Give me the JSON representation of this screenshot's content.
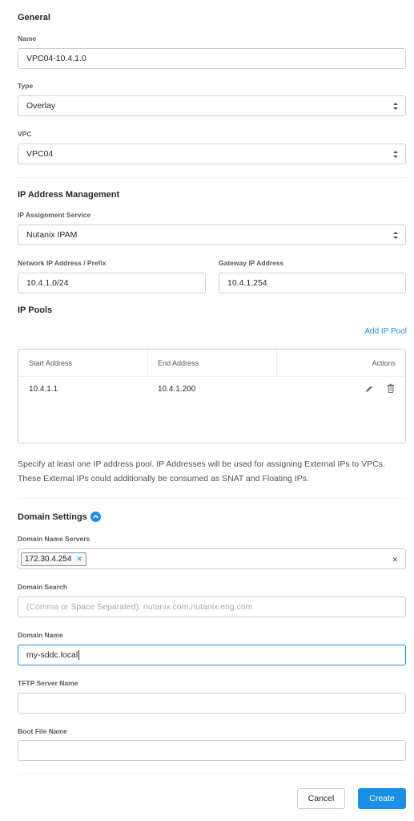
{
  "general": {
    "title": "General",
    "name_label": "Name",
    "name_value": "VPC04-10.4.1.0",
    "type_label": "Type",
    "type_value": "Overlay",
    "vpc_label": "VPC",
    "vpc_value": "VPC04"
  },
  "ipam": {
    "title": "IP Address Management",
    "service_label": "IP Assignment Service",
    "service_value": "Nutanix IPAM",
    "network_label": "Network IP Address / Prefix",
    "network_value": "10.4.1.0/24",
    "gateway_label": "Gateway IP Address",
    "gateway_value": "10.4.1.254"
  },
  "ip_pools": {
    "title": "IP Pools",
    "add_link": "Add IP Pool",
    "columns": [
      "Start Address",
      "End Address",
      "Actions"
    ],
    "rows": [
      {
        "start": "10.4.1.1",
        "end": "10.4.1.200"
      }
    ],
    "info": "Specify at least one IP address pool. IP Addresses will be used for assigning External IPs to VPCs. These External IPs could additionally be consumed as SNAT and Floating IPs."
  },
  "domain": {
    "title": "Domain Settings",
    "dns_label": "Domain Name Servers",
    "dns_tags": [
      "172.30.4.254"
    ],
    "search_label": "Domain Search",
    "search_placeholder": "(Comma or Space Separated): nutanix.com,nutanix.eng.com",
    "name_label": "Domain Name",
    "name_value": "my-sddc.local",
    "tftp_label": "TFTP Server Name",
    "tftp_value": "",
    "boot_label": "Boot File Name",
    "boot_value": ""
  },
  "footer": {
    "cancel_label": "Cancel",
    "create_label": "Create"
  },
  "colors": {
    "accent": "#1b8fe5",
    "border": "#c9ced4",
    "text": "#22272e"
  },
  "icons": {
    "edit": "pencil-icon",
    "delete": "trash-icon",
    "collapse": "chevron-up-icon",
    "clear": "close-icon"
  }
}
